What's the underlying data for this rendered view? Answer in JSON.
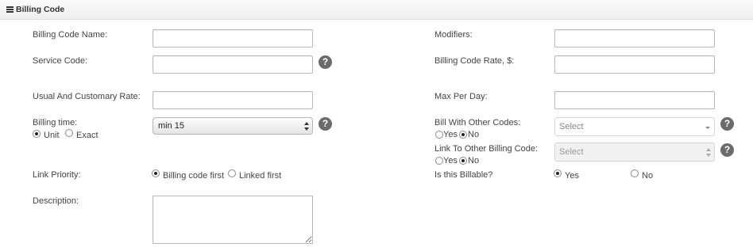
{
  "panel": {
    "title": "Billing Code"
  },
  "left": {
    "billing_code_name": {
      "label": "Billing Code Name:",
      "value": ""
    },
    "service_code": {
      "label": "Service Code:",
      "value": ""
    },
    "usual_rate": {
      "label": "Usual And Customary Rate:",
      "value": ""
    },
    "billing_time": {
      "label": "Billing time:",
      "options": [
        "Unit",
        "Exact"
      ],
      "selected": "Unit",
      "select_value": "min 15"
    },
    "link_priority": {
      "label": "Link Priority:",
      "options": [
        "Billing code first",
        "Linked first"
      ],
      "selected": "Billing code first"
    },
    "description": {
      "label": "Description:",
      "value": ""
    }
  },
  "right": {
    "modifiers": {
      "label": "Modifiers:",
      "value": ""
    },
    "billing_code_rate": {
      "label": "Billing Code Rate, $:",
      "value": ""
    },
    "max_per_day": {
      "label": "Max Per Day:",
      "value": ""
    },
    "bill_with_other": {
      "label": "Bill With Other Codes:",
      "options": [
        "Yes",
        "No"
      ],
      "selected": "No",
      "select_placeholder": "Select"
    },
    "link_to_other": {
      "label": "Link To Other Billing Code:",
      "options": [
        "Yes",
        "No"
      ],
      "selected": "No",
      "select_placeholder": "Select"
    },
    "is_billable": {
      "label": "Is this Billable?",
      "options": [
        "Yes",
        "No"
      ],
      "selected": "Yes"
    }
  },
  "help_glyph": "?"
}
